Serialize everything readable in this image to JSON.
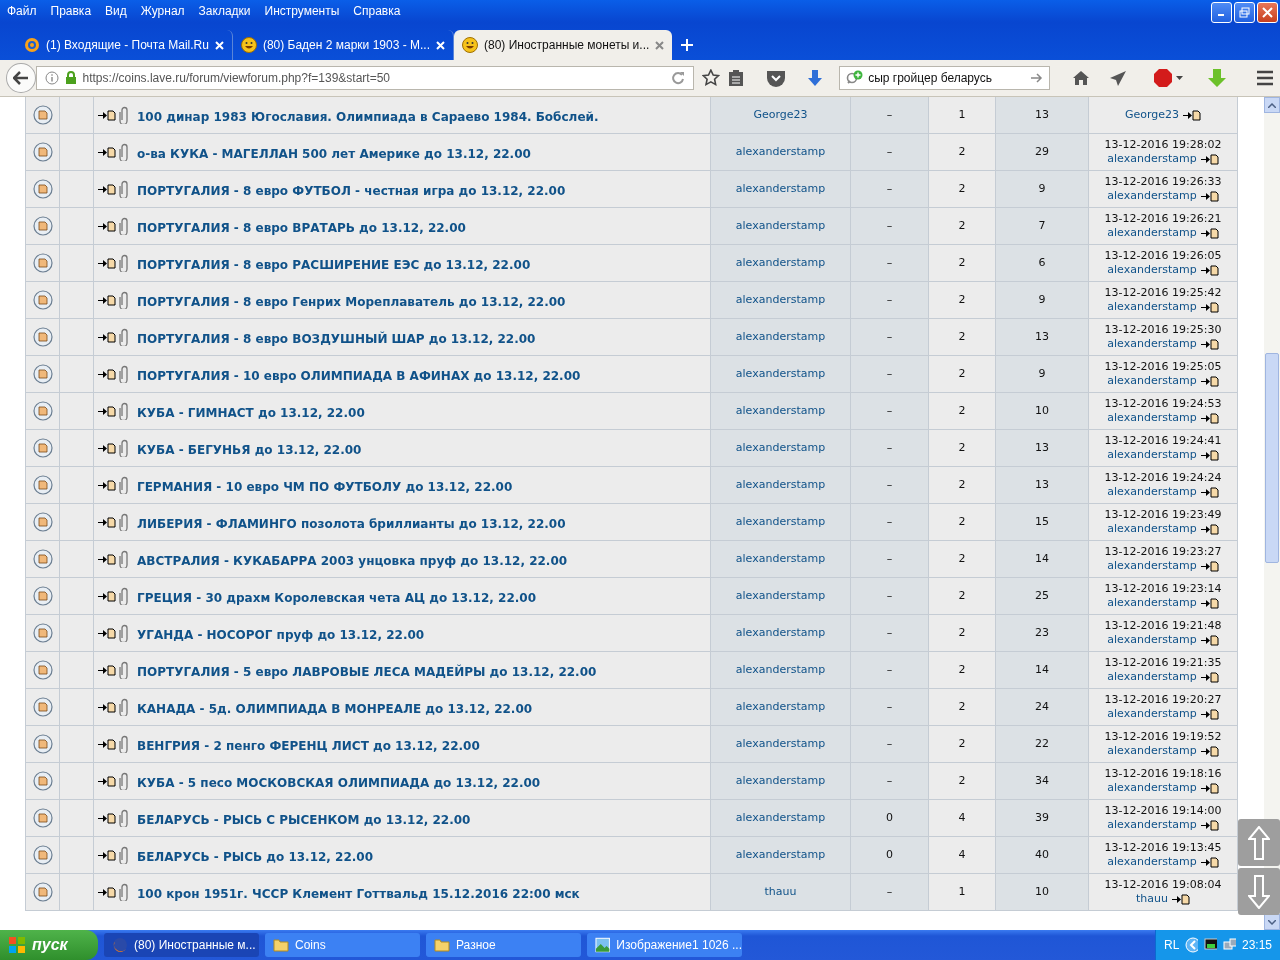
{
  "menu_bar": [
    "Файл",
    "Правка",
    "Вид",
    "Журнал",
    "Закладки",
    "Инструменты",
    "Справка"
  ],
  "tabs": [
    {
      "label": "(1) Входящие - Почта Mail.Ru",
      "kind": "mail",
      "selected": false
    },
    {
      "label": "(80) Баден 2 марки 1903 - М...",
      "kind": "smiley",
      "selected": false
    },
    {
      "label": "(80) Иностранные монеты и...",
      "kind": "smiley",
      "selected": true
    }
  ],
  "address_bar": {
    "url": "https://coins.lave.ru/forum/viewforum.php?f=139&start=50"
  },
  "search": {
    "value": "сыр гройцер беларусь"
  },
  "topics": [
    {
      "title": "100 динар 1983 Югославия. Олимпиада в Сараево 1984. Бобслей.",
      "author": "George23",
      "column_5": "–",
      "column_6": "1",
      "column_7": "13",
      "last_post_author": "George23"
    },
    {
      "title": "о-ва КУКА - МАГЕЛЛАН 500 лет Америке до 13.12, 22.00",
      "author": "alexanderstamp",
      "column_5": "–",
      "column_6": "2",
      "column_7": "29",
      "last_post_time": "13-12-2016 19:28:02",
      "last_post_author": "alexanderstamp"
    },
    {
      "title": "ПОРТУГАЛИЯ - 8 евро ФУТБОЛ - честная игра до 13.12, 22.00",
      "author": "alexanderstamp",
      "column_5": "–",
      "column_6": "2",
      "column_7": "9",
      "last_post_time": "13-12-2016 19:26:33",
      "last_post_author": "alexanderstamp"
    },
    {
      "title": "ПОРТУГАЛИЯ - 8 евро ВРАТАРЬ до 13.12, 22.00",
      "author": "alexanderstamp",
      "column_5": "–",
      "column_6": "2",
      "column_7": "7",
      "last_post_time": "13-12-2016 19:26:21",
      "last_post_author": "alexanderstamp"
    },
    {
      "title": "ПОРТУГАЛИЯ - 8 евро РАСШИРЕНИЕ ЕЭС до 13.12, 22.00",
      "author": "alexanderstamp",
      "column_5": "–",
      "column_6": "2",
      "column_7": "6",
      "last_post_time": "13-12-2016 19:26:05",
      "last_post_author": "alexanderstamp"
    },
    {
      "title": "ПОРТУГАЛИЯ - 8 евро Генрих Мореплаватель до 13.12, 22.00",
      "author": "alexanderstamp",
      "column_5": "–",
      "column_6": "2",
      "column_7": "9",
      "last_post_time": "13-12-2016 19:25:42",
      "last_post_author": "alexanderstamp"
    },
    {
      "title": "ПОРТУГАЛИЯ - 8 евро ВОЗДУШНЫЙ ШАР до 13.12, 22.00",
      "author": "alexanderstamp",
      "column_5": "–",
      "column_6": "2",
      "column_7": "13",
      "last_post_time": "13-12-2016 19:25:30",
      "last_post_author": "alexanderstamp"
    },
    {
      "title": "ПОРТУГАЛИЯ - 10 евро ОЛИМПИАДА В АФИНАХ до 13.12, 22.00",
      "author": "alexanderstamp",
      "column_5": "–",
      "column_6": "2",
      "column_7": "9",
      "last_post_time": "13-12-2016 19:25:05",
      "last_post_author": "alexanderstamp"
    },
    {
      "title": "КУБА - ГИМНАСТ до 13.12, 22.00",
      "author": "alexanderstamp",
      "column_5": "–",
      "column_6": "2",
      "column_7": "10",
      "last_post_time": "13-12-2016 19:24:53",
      "last_post_author": "alexanderstamp"
    },
    {
      "title": "КУБА - БЕГУНЬЯ до 13.12, 22.00",
      "author": "alexanderstamp",
      "column_5": "–",
      "column_6": "2",
      "column_7": "13",
      "last_post_time": "13-12-2016 19:24:41",
      "last_post_author": "alexanderstamp"
    },
    {
      "title": "ГЕРМАНИЯ - 10 евро ЧМ ПО ФУТБОЛУ до 13.12, 22.00",
      "author": "alexanderstamp",
      "column_5": "–",
      "column_6": "2",
      "column_7": "13",
      "last_post_time": "13-12-2016 19:24:24",
      "last_post_author": "alexanderstamp"
    },
    {
      "title": "ЛИБЕРИЯ - ФЛАМИНГО позолота бриллианты до 13.12, 22.00",
      "author": "alexanderstamp",
      "column_5": "–",
      "column_6": "2",
      "column_7": "15",
      "last_post_time": "13-12-2016 19:23:49",
      "last_post_author": "alexanderstamp"
    },
    {
      "title": "АВСТРАЛИЯ - КУКАБАРРА 2003 унцовка пруф до 13.12, 22.00",
      "author": "alexanderstamp",
      "column_5": "–",
      "column_6": "2",
      "column_7": "14",
      "last_post_time": "13-12-2016 19:23:27",
      "last_post_author": "alexanderstamp"
    },
    {
      "title": "ГРЕЦИЯ - 30 драхм Королевская чета АЦ до 13.12, 22.00",
      "author": "alexanderstamp",
      "column_5": "–",
      "column_6": "2",
      "column_7": "25",
      "last_post_time": "13-12-2016 19:23:14",
      "last_post_author": "alexanderstamp"
    },
    {
      "title": "УГАНДА - НОСОРОГ пруф до 13.12, 22.00",
      "author": "alexanderstamp",
      "column_5": "–",
      "column_6": "2",
      "column_7": "23",
      "last_post_time": "13-12-2016 19:21:48",
      "last_post_author": "alexanderstamp"
    },
    {
      "title": "ПОРТУГАЛИЯ - 5 евро ЛАВРОВЫЕ ЛЕСА МАДЕЙРЫ до 13.12, 22.00",
      "author": "alexanderstamp",
      "column_5": "–",
      "column_6": "2",
      "column_7": "14",
      "last_post_time": "13-12-2016 19:21:35",
      "last_post_author": "alexanderstamp"
    },
    {
      "title": "КАНАДА - 5д. ОЛИМПИАДА В МОНРЕАЛЕ до 13.12, 22.00",
      "author": "alexanderstamp",
      "column_5": "–",
      "column_6": "2",
      "column_7": "24",
      "last_post_time": "13-12-2016 19:20:27",
      "last_post_author": "alexanderstamp"
    },
    {
      "title": "ВЕНГРИЯ - 2 пенго ФЕРЕНЦ ЛИСТ до 13.12, 22.00",
      "author": "alexanderstamp",
      "column_5": "–",
      "column_6": "2",
      "column_7": "22",
      "last_post_time": "13-12-2016 19:19:52",
      "last_post_author": "alexanderstamp"
    },
    {
      "title": "КУБА - 5 песо МОСКОВСКАЯ ОЛИМПИАДА до 13.12, 22.00",
      "author": "alexanderstamp",
      "column_5": "–",
      "column_6": "2",
      "column_7": "34",
      "last_post_time": "13-12-2016 19:18:16",
      "last_post_author": "alexanderstamp"
    },
    {
      "title": "БЕЛАРУСЬ - РЫСЬ С РЫСЕНКОМ до 13.12, 22.00",
      "author": "alexanderstamp",
      "column_5": "0",
      "column_6": "4",
      "column_7": "39",
      "last_post_time": "13-12-2016 19:14:00",
      "last_post_author": "alexanderstamp"
    },
    {
      "title": "БЕЛАРУСЬ - РЫСЬ до 13.12, 22.00",
      "author": "alexanderstamp",
      "column_5": "0",
      "column_6": "4",
      "column_7": "40",
      "last_post_time": "13-12-2016 19:13:45",
      "last_post_author": "alexanderstamp"
    },
    {
      "title": "100 крон 1951г. ЧССР Клемент Готтвальд 15.12.2016 22:00 мск",
      "author": "thauu",
      "column_5": "–",
      "column_6": "1",
      "column_7": "10",
      "last_post_time": "13-12-2016 19:08:04",
      "last_post_author": "thauu"
    }
  ],
  "taskbar": {
    "start": "пуск",
    "tasks": [
      {
        "label": "(80) Иностранные м...",
        "kind": "browser",
        "selected": true
      },
      {
        "label": "Coins",
        "kind": "folder",
        "selected": false
      },
      {
        "label": "Разное",
        "kind": "folder",
        "selected": false
      },
      {
        "label": "Изображение1 1026 ...",
        "kind": "image",
        "selected": false
      }
    ],
    "language": "RL",
    "clock": "23:15"
  }
}
